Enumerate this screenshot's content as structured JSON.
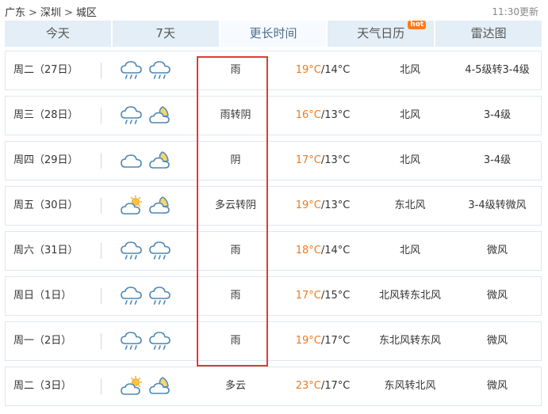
{
  "breadcrumb": [
    "广东",
    "深圳",
    "城区"
  ],
  "breadcrumb_separator": ">",
  "updated": "11:30更新",
  "tabs": [
    {
      "label": "今天",
      "active": false
    },
    {
      "label": "7天",
      "active": false
    },
    {
      "label": "更长时间",
      "active": true
    },
    {
      "label": "天气日历",
      "active": false,
      "badge": "hot"
    },
    {
      "label": "雷达图",
      "active": false
    }
  ],
  "colors": {
    "high_temp": "#ef7a1e",
    "highlight_box": "#e0393b",
    "tab_bg": "#e3eef6",
    "badge": "#ff7a1a"
  },
  "forecast": [
    {
      "day": "周二（27日）",
      "icons": [
        "rain-icon",
        "rain-icon"
      ],
      "condition": "雨",
      "high": "19°C",
      "low": "/14°C",
      "wind": "北风",
      "level": "4-5级转3-4级"
    },
    {
      "day": "周三（28日）",
      "icons": [
        "rain-icon",
        "cloudy-night-icon"
      ],
      "condition": "雨转阴",
      "high": "16°C",
      "low": "/13°C",
      "wind": "北风",
      "level": "3-4级"
    },
    {
      "day": "周四（29日）",
      "icons": [
        "overcast-icon",
        "cloudy-night-icon"
      ],
      "condition": "阴",
      "high": "17°C",
      "low": "/13°C",
      "wind": "北风",
      "level": "3-4级"
    },
    {
      "day": "周五（30日）",
      "icons": [
        "partly-cloudy-icon",
        "cloudy-night-icon"
      ],
      "condition": "多云转阴",
      "high": "19°C",
      "low": "/13°C",
      "wind": "东北风",
      "level": "3-4级转微风"
    },
    {
      "day": "周六（31日）",
      "icons": [
        "rain-icon",
        "rain-icon"
      ],
      "condition": "雨",
      "high": "18°C",
      "low": "/14°C",
      "wind": "北风",
      "level": "微风"
    },
    {
      "day": "周日（1日）",
      "icons": [
        "rain-icon",
        "rain-icon"
      ],
      "condition": "雨",
      "high": "17°C",
      "low": "/15°C",
      "wind": "北风转东北风",
      "level": "微风"
    },
    {
      "day": "周一（2日）",
      "icons": [
        "rain-icon",
        "rain-icon"
      ],
      "condition": "雨",
      "high": "19°C",
      "low": "/17°C",
      "wind": "东北风转东风",
      "level": "微风"
    },
    {
      "day": "周二（3日）",
      "icons": [
        "partly-cloudy-icon",
        "partly-cloudy-night-icon"
      ],
      "condition": "多云",
      "high": "23°C",
      "low": "/17°C",
      "wind": "东风转北风",
      "level": "微风"
    }
  ]
}
